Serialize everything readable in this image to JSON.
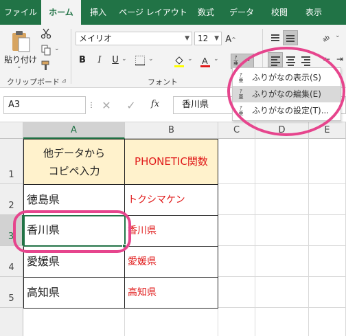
{
  "ribbon_tabs": [
    "ファイル",
    "ホーム",
    "挿入",
    "ページ レイアウト",
    "数式",
    "データ",
    "校閲",
    "表示"
  ],
  "active_tab": "ホーム",
  "clipboard": {
    "paste_label": "貼り付け",
    "group_label": "クリップボード"
  },
  "font": {
    "name": "メイリオ",
    "size": "12",
    "group_label": "フォント",
    "bold": "B",
    "italic": "I",
    "underline": "U",
    "font_color": "#e01a1a",
    "fill_color": "#ffff00"
  },
  "phonetic_menu": {
    "items": [
      "ふりがなの表示(S)",
      "ふりがなの編集(E)",
      "ふりがなの設定(T)..."
    ],
    "highlighted": "ふりがなの編集(E)"
  },
  "formula_bar": {
    "name_box": "A3",
    "fx_label": "fx",
    "content": "香川県"
  },
  "columns": [
    "A",
    "B",
    "C",
    "D",
    "E"
  ],
  "rows": [
    "1",
    "2",
    "3",
    "4",
    "5"
  ],
  "cells": {
    "A1": "他データから\nコピペ入力",
    "B1": "PHONETIC関数",
    "A2": "徳島県",
    "B2": "トクシマケン",
    "A3": "香川県",
    "B3": "香川県",
    "A4": "愛媛県",
    "B4": "愛媛県",
    "A5": "高知県",
    "B5": "高知県"
  },
  "colors": {
    "excel_green": "#217346",
    "header_fill": "#fff2cc",
    "formula_red": "#e01a1a",
    "annotation_pink": "#e6458d"
  }
}
